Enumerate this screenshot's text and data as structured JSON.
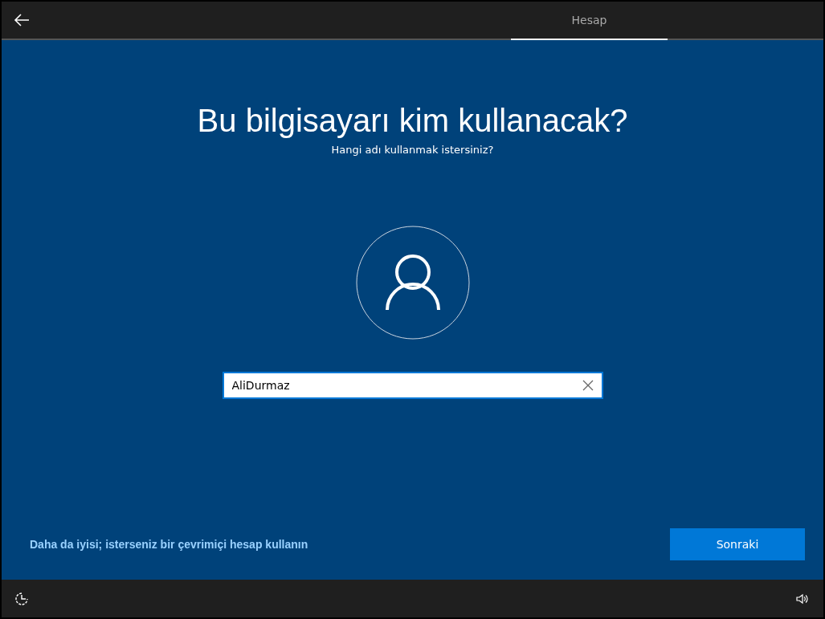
{
  "tabs": [
    {
      "label": "Hesap",
      "selected": true
    }
  ],
  "heading": "Bu bilgisayarı kim kullanacak?",
  "subheading": "Hangi adı kullanmak istersiniz?",
  "name_field": {
    "value": "AliDurmaz"
  },
  "online_account_link": "Daha da iyisi; isterseniz bir çevrimiçi hesap kullanın",
  "next_button": "Sonraki"
}
